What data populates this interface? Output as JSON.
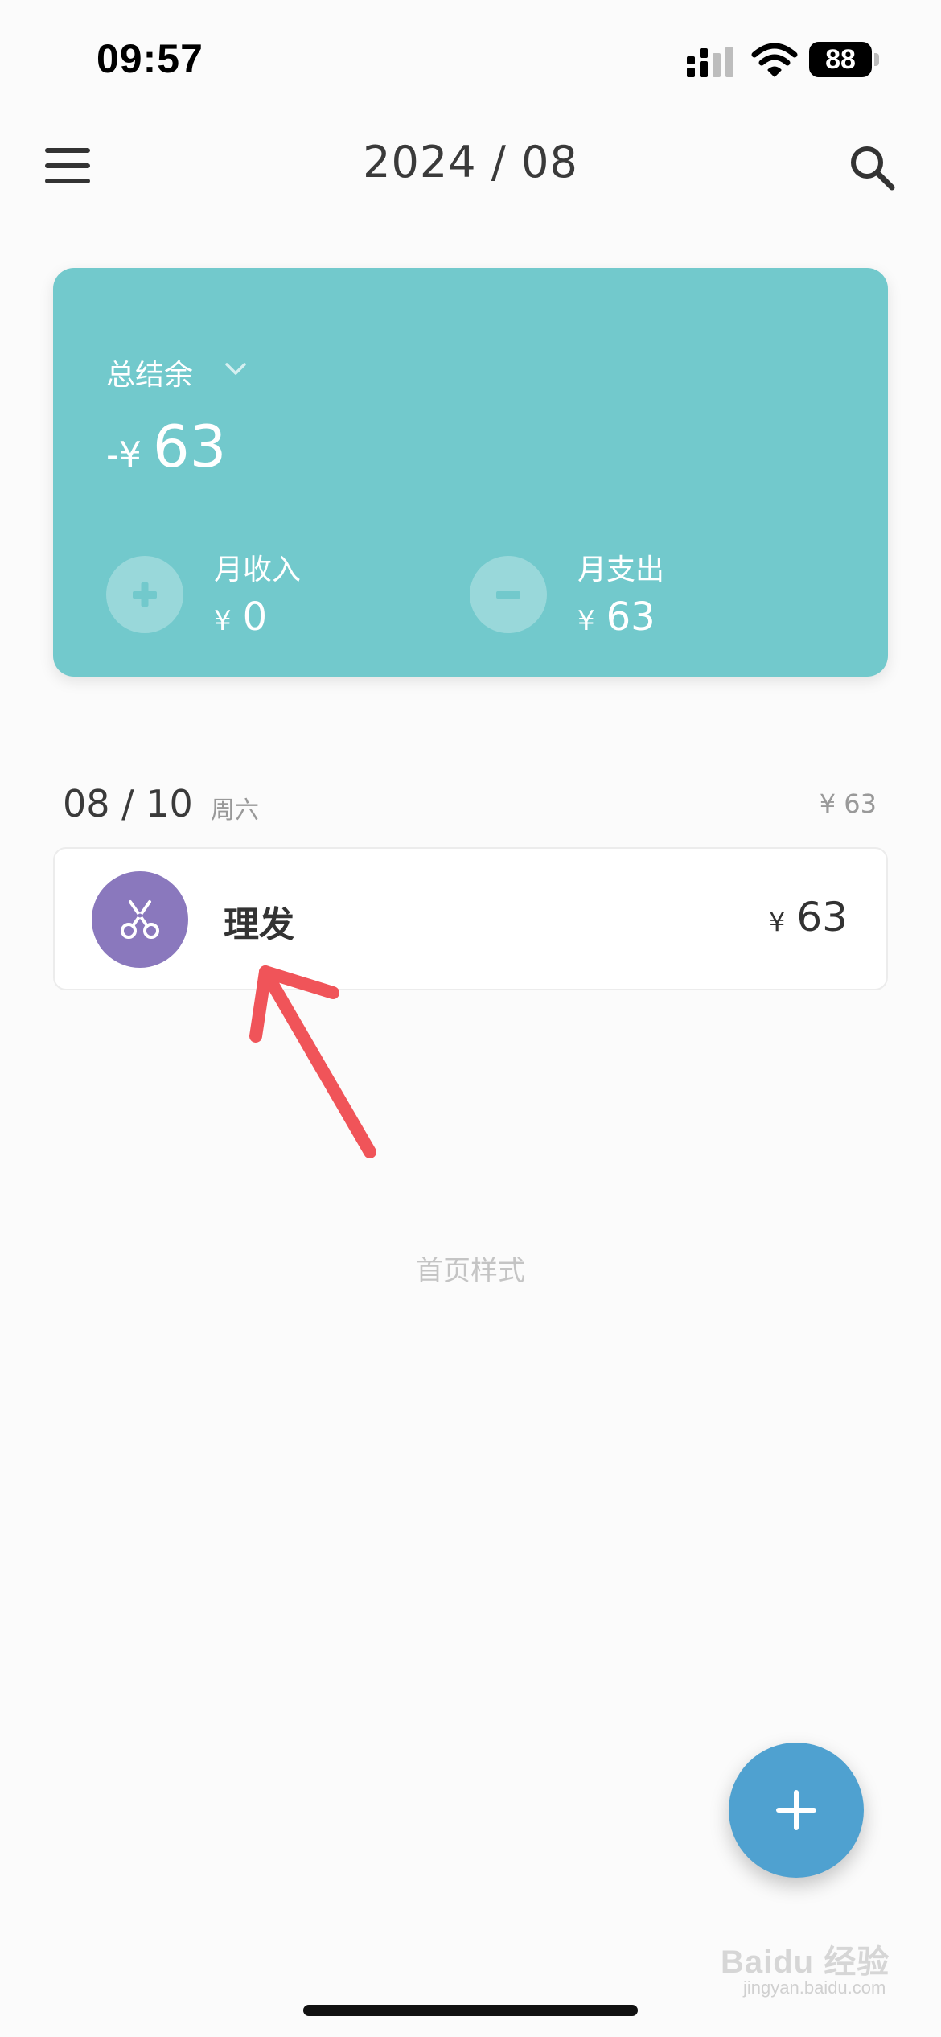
{
  "status_bar": {
    "time": "09:57",
    "battery": "88",
    "icons": [
      "signal-icon",
      "wifi-icon",
      "battery-icon"
    ]
  },
  "header": {
    "title": "2024 / 08",
    "menu_icon": "menu-icon",
    "search_icon": "search-icon"
  },
  "balance": {
    "label": "总结余",
    "sign_currency": "-¥",
    "amount": "63",
    "income": {
      "label": "月收入",
      "currency": "¥",
      "value": "0"
    },
    "expense": {
      "label": "月支出",
      "currency": "¥",
      "value": "63"
    }
  },
  "day": {
    "date": "08 / 10",
    "weekday": "周六",
    "total": "¥ 63",
    "records": [
      {
        "name": "理发",
        "currency": "¥",
        "amount": "63",
        "icon": "scissors-icon"
      }
    ]
  },
  "footer_caption": "首页样式",
  "watermark": {
    "main": "Baidu 经验",
    "sub": "jingyan.baidu.com"
  },
  "colors": {
    "card": "#72c9cc",
    "category": "#8a78bd",
    "fab": "#4fa1d0",
    "annotation_arrow": "#f05459"
  }
}
